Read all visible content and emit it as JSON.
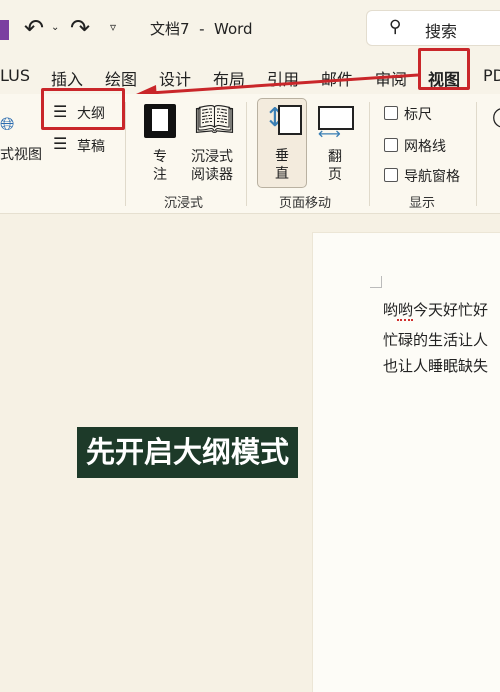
{
  "titlebar": {
    "title": "文档7  -  Word",
    "search_label": "搜索"
  },
  "tabs": [
    "LUS",
    "插入",
    "绘图",
    "设计",
    "布局",
    "引用",
    "邮件",
    "审阅",
    "视图",
    "PD"
  ],
  "active_tab": "视图",
  "ribbon": {
    "views": {
      "web_layout": "式视图",
      "outline": "大纲",
      "draft": "草稿"
    },
    "immersive": {
      "focus": [
        "专",
        "注"
      ],
      "reader": [
        "沉浸式",
        "阅读器"
      ],
      "group": "沉浸式"
    },
    "page_movement": {
      "vertical": [
        "垂",
        "直"
      ],
      "side": [
        "翻",
        "页"
      ],
      "group": "页面移动"
    },
    "show": {
      "ruler": "标尺",
      "gridlines": "网格线",
      "nav_pane": "导航窗格",
      "group": "显示"
    }
  },
  "document": {
    "lines": [
      "哟哟今天好忙好",
      "忙碌的生活让人",
      "也让人睡眠缺失"
    ]
  },
  "caption": "先开启大纲模式",
  "colors": {
    "highlight": "#c9262a",
    "caption_bg": "#1d3a29",
    "word_purple": "#7b3fa0"
  }
}
